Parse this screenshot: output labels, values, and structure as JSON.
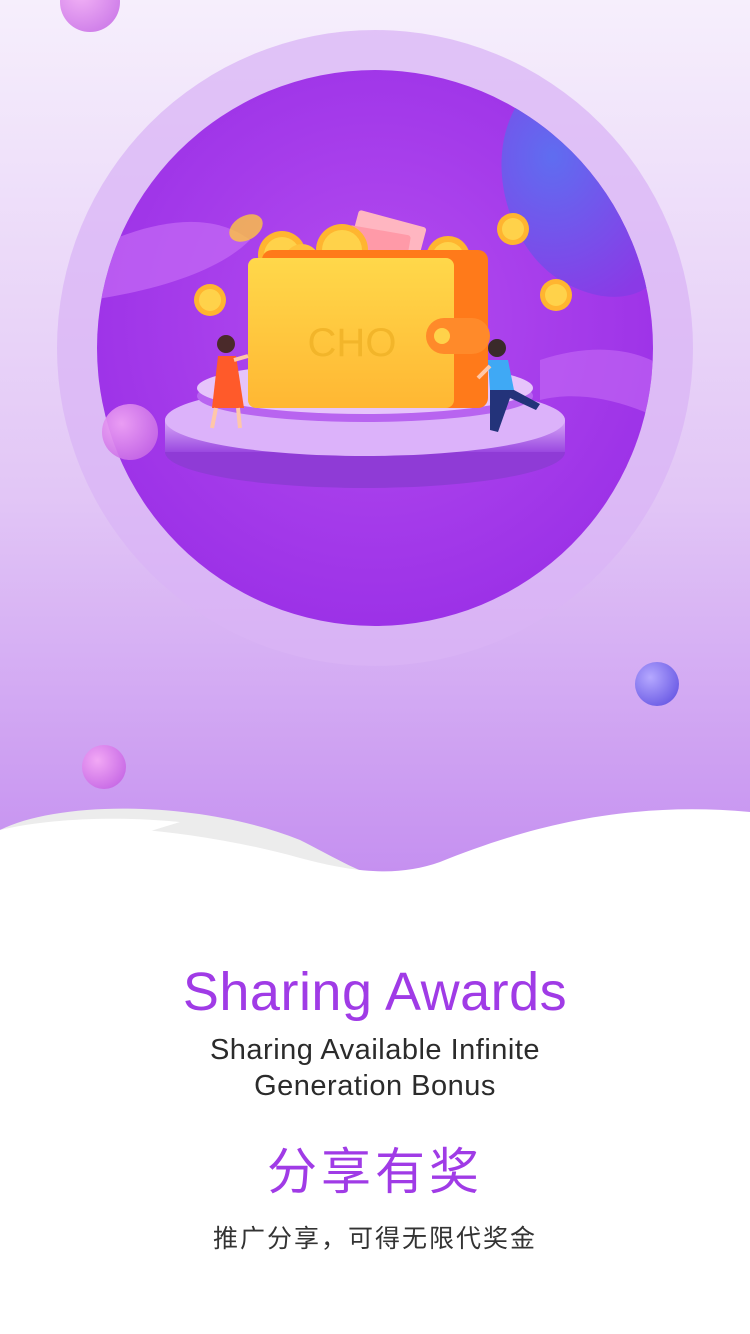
{
  "illustration": {
    "wallet_label": "CHO"
  },
  "content": {
    "title_en": "Sharing Awards",
    "subtitle_en_line1": "Sharing Available Infinite",
    "subtitle_en_line2": "Generation Bonus",
    "title_zh": "分享有奖",
    "subtitle_zh": "推广分享，可得无限代奖金"
  },
  "colors": {
    "accent": "#a03be6",
    "wallet": "#ffcf3a",
    "background_top": "#f4ecfb",
    "background_bottom": "#c690f2"
  }
}
